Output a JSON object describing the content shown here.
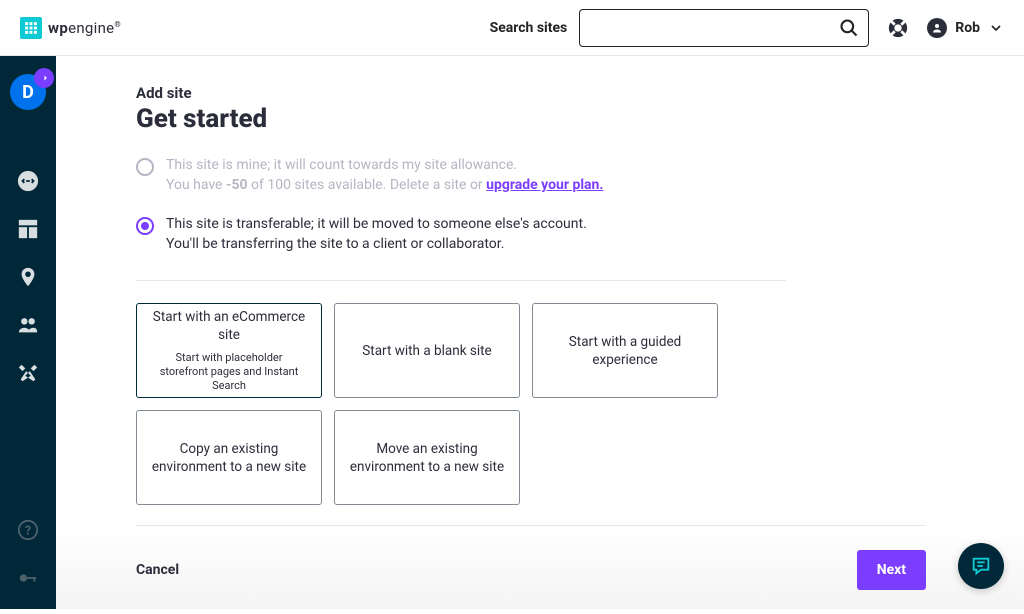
{
  "header": {
    "logo_text_prefix": "wp",
    "logo_text_suffix": "engine",
    "search_label": "Search sites",
    "search_placeholder": "",
    "user_name": "Rob"
  },
  "sidebar": {
    "org_initial": "D"
  },
  "page": {
    "eyebrow": "Add site",
    "title": "Get started",
    "radio_own_line1": "This site is mine; it will count towards my site allowance.",
    "radio_own_line2_prefix": "You have ",
    "radio_own_available_bold": "-50",
    "radio_own_line2_mid": " of 100 sites available. Delete a site or ",
    "upgrade_link_text": "upgrade your plan.",
    "radio_transfer_line1": "This site is transferable; it will be moved to someone else's account.",
    "radio_transfer_line2": "You'll be transferring the site to a client or collaborator."
  },
  "cards": [
    {
      "title": "Start with an eCommerce site",
      "sub": "Start with placeholder storefront pages and Instant Search"
    },
    {
      "title": "Start with a blank site",
      "sub": ""
    },
    {
      "title": "Start with a guided experience",
      "sub": ""
    },
    {
      "title": "Copy an existing environment to a new site",
      "sub": ""
    },
    {
      "title": "Move an existing environment to a new site",
      "sub": ""
    }
  ],
  "footer": {
    "cancel": "Cancel",
    "next": "Next"
  }
}
